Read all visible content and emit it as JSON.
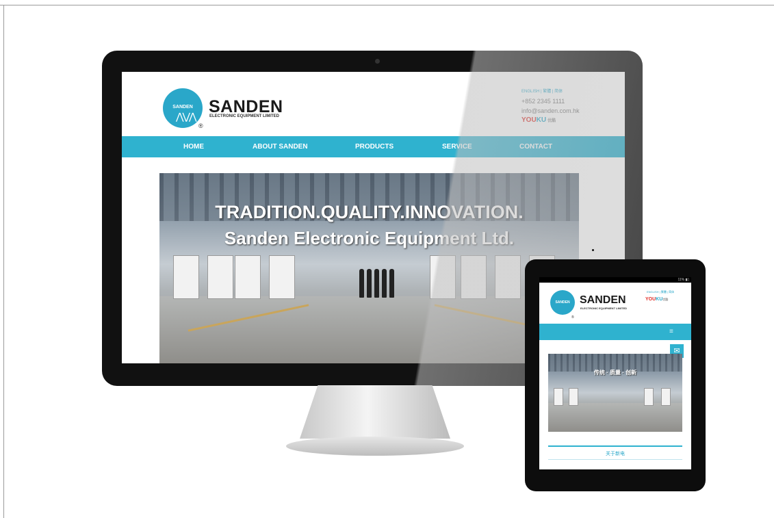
{
  "desktop": {
    "logo_text": "SANDEN",
    "registered": "®",
    "brand_name": "SANDEN",
    "brand_sub": "ELECTRONIC EQUIPMENT LIMITED",
    "contact": {
      "languages": "ENGLISH | 繁體 | 简体",
      "phone": "+852 2345 1111",
      "email": "info@sanden.com.hk",
      "youku_you": "YOU",
      "youku_ku": "KU",
      "youku_cn": "优酷"
    },
    "nav": [
      "HOME",
      "ABOUT SANDEN",
      "PRODUCTS",
      "SERVICE",
      "CONTACT"
    ],
    "hero_title": "TRADITION.QUALITY.INNOVATION.",
    "hero_subtitle": "Sanden Electronic Equipment Ltd."
  },
  "tablet": {
    "status": "11% ▮▯",
    "logo_text": "SANDEN",
    "registered": "®",
    "brand_name": "SANDEN",
    "brand_sub": "ELECTRONIC EQUIPMENT LIMITED",
    "languages": "ENGLISH | 繁體 | 简体",
    "youku_you": "YOU",
    "youku_ku": "KU",
    "youku_cn": "优酷",
    "menu_icon": "hamburger-icon",
    "mail_icon": "envelope-icon",
    "hero_text": "传统 · 质量 · 创新",
    "about_label": "关于新电"
  },
  "colors": {
    "accent": "#2fb2cf",
    "logo": "#2aa7c9",
    "youku_red": "#e0312b"
  }
}
